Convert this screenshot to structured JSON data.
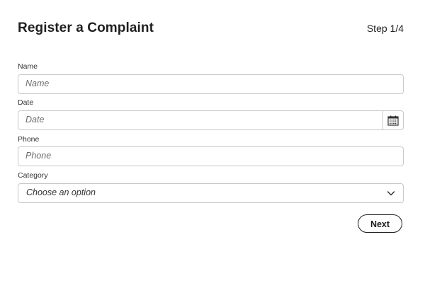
{
  "header": {
    "title": "Register a Complaint",
    "step": "Step 1/4"
  },
  "form": {
    "name": {
      "label": "Name",
      "placeholder": "Name",
      "value": ""
    },
    "date": {
      "label": "Date",
      "placeholder": "Date",
      "value": "",
      "icon": "calendar-icon"
    },
    "phone": {
      "label": "Phone",
      "placeholder": "Phone",
      "value": ""
    },
    "category": {
      "label": "Category",
      "selected": "Choose an option",
      "icon": "chevron-down-icon"
    }
  },
  "actions": {
    "next_label": "Next"
  },
  "colors": {
    "border": "#c8c8c8",
    "text": "#222222",
    "placeholder": "#6e6e6e",
    "button_border": "#1e1e1e"
  }
}
